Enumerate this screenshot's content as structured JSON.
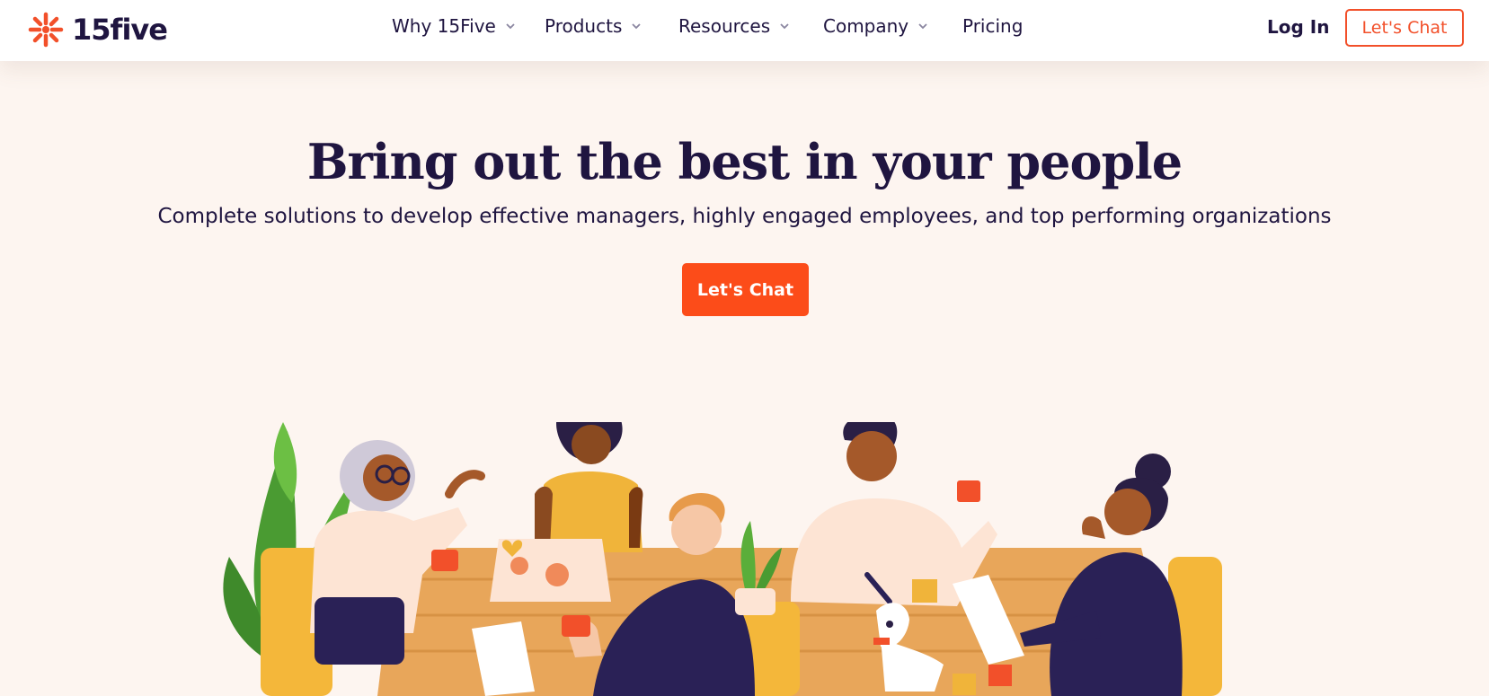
{
  "header": {
    "logo_text": "15five",
    "nav": [
      {
        "label": "Why 15Five",
        "has_dropdown": true
      },
      {
        "label": "Products",
        "has_dropdown": true
      },
      {
        "label": "Resources",
        "has_dropdown": true
      },
      {
        "label": "Company",
        "has_dropdown": true
      },
      {
        "label": "Pricing",
        "has_dropdown": false
      }
    ],
    "login_label": "Log In",
    "chat_label": "Let's Chat"
  },
  "hero": {
    "title": "Bring out the best in your people",
    "subtitle": "Complete solutions to develop effective managers, highly engaged employees, and top performing organizations",
    "cta_label": "Let's Chat"
  },
  "colors": {
    "accent": "#fc4c19",
    "text": "#1f1540",
    "background": "#fdf5f0"
  },
  "icons": [
    "burst-logo-icon",
    "chevron-down-icon"
  ]
}
